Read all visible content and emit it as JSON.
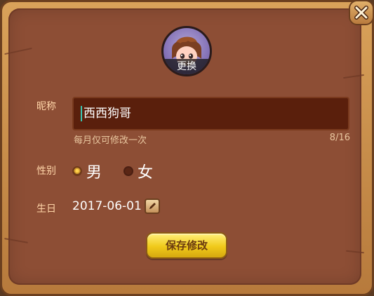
{
  "avatar": {
    "change_label": "更换"
  },
  "form": {
    "nickname_label": "昵称",
    "nickname_value": "西西狗哥",
    "nickname_hint": "每月仅可修改一次",
    "nickname_counter": "8/16",
    "gender_label": "性别",
    "gender_options": [
      "男",
      "女"
    ],
    "gender_selected": "男",
    "birthday_label": "生日",
    "birthday_value": "2017-06-01"
  },
  "actions": {
    "save_label": "保存修改"
  },
  "colors": {
    "panel": "#8d4e35",
    "input_bg": "#5a1f0c",
    "accent": "#f0c91a",
    "label": "#ffd5a8"
  },
  "icons": {
    "close": "close-icon",
    "edit": "edit-icon"
  }
}
